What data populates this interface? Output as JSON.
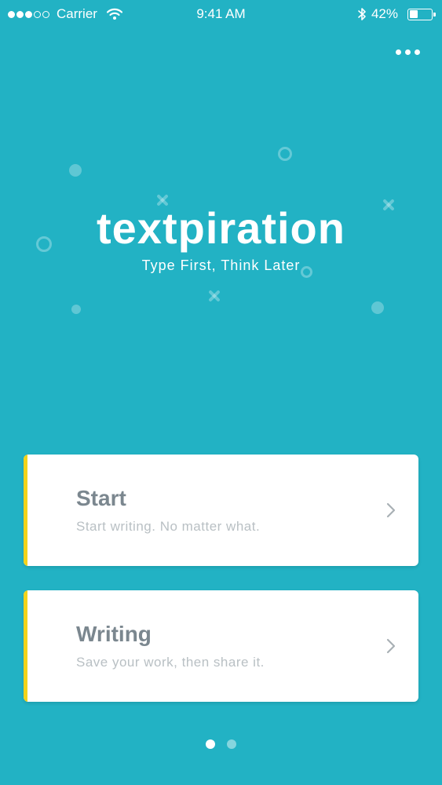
{
  "status_bar": {
    "carrier": "Carrier",
    "time": "9:41 AM",
    "battery_percent": "42%",
    "battery_level": 0.42,
    "signal_bars_filled": 3,
    "signal_bars_total": 5
  },
  "header": {
    "more_icon": "more-horizontal-icon"
  },
  "logo": {
    "title": "textpiration",
    "tagline": "Type First, Think Later"
  },
  "cards": [
    {
      "title": "Start",
      "subtitle": "Start writing. No matter what.",
      "accent_color": "#f2d31b",
      "icon": "chevron-right-icon"
    },
    {
      "title": "Writing",
      "subtitle": "Save your work, then share it.",
      "accent_color": "#f2d31b",
      "icon": "chevron-right-icon"
    }
  ],
  "page_indicator": {
    "count": 2,
    "active_index": 0
  },
  "colors": {
    "background": "#22b2c4",
    "card_background": "#ffffff",
    "title_text": "#7b878f",
    "subtitle_text": "#b9c0c4"
  }
}
